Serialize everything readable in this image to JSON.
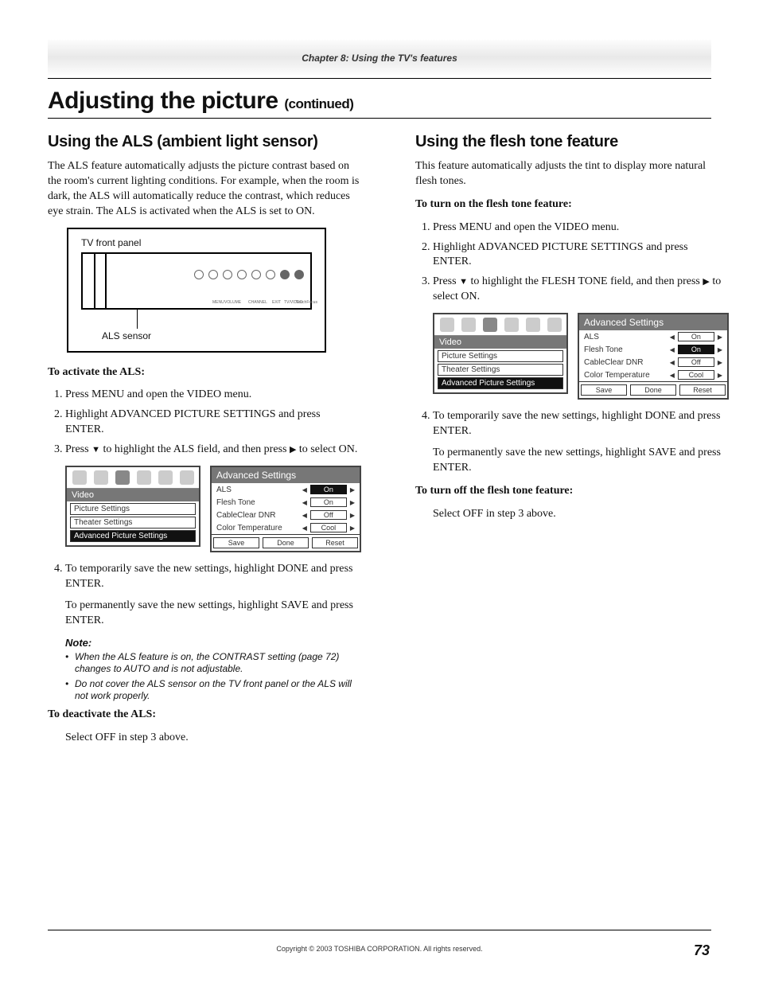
{
  "header": {
    "chapter": "Chapter 8: Using the TV's features"
  },
  "h1": {
    "title": "Adjusting the picture",
    "cont": "(continued)"
  },
  "left": {
    "h2": "Using the ALS (ambient light sensor)",
    "intro": "The ALS feature automatically adjusts the picture contrast based on the room's current lighting conditions. For example, when the room is dark, the ALS will automatically reduce the contrast, which reduces eye strain. The ALS is activated when the ALS is set to ON.",
    "tv_label_top": "TV front panel",
    "tv_label_sensor": "ALS sensor",
    "activate_hd": "To activate the ALS:",
    "steps": {
      "s1": "Press MENU and open the VIDEO menu.",
      "s2": "Highlight ADVANCED PICTURE SETTINGS and press ENTER.",
      "s3a": "Press ",
      "s3b": " to highlight the ALS field, and then press ",
      "s3c": " to select ON.",
      "s4": "To temporarily save the new settings, highlight DONE and press ENTER.",
      "s4p2": "To permanently save the new settings, highlight SAVE and press ENTER."
    },
    "note_hd": "Note:",
    "note1": "When the ALS feature is on, the CONTRAST setting (page 72) changes to AUTO and is not adjustable.",
    "note2": "Do not cover the ALS sensor on the TV front panel or the ALS will not work properly.",
    "deactivate_hd": "To deactivate the ALS:",
    "deactivate_body": "Select OFF in step 3 above."
  },
  "right": {
    "h2": "Using the flesh tone feature",
    "intro": "This feature automatically adjusts the tint to display more natural flesh tones.",
    "on_hd": "To turn on the flesh tone feature:",
    "steps": {
      "s1": "Press MENU and open the VIDEO menu.",
      "s2": "Highlight ADVANCED PICTURE SETTINGS and press ENTER.",
      "s3a": "Press ",
      "s3b": " to highlight the FLESH TONE field, and then press ",
      "s3c": " to select ON.",
      "s4": "To temporarily save the new settings, highlight DONE and press ENTER.",
      "s4p2": "To permanently save the new settings, highlight SAVE and press ENTER."
    },
    "off_hd": "To turn off the flesh tone feature:",
    "off_body": "Select OFF in step 3 above."
  },
  "menu": {
    "cat_title": "Video",
    "cat_items": [
      "Picture Settings",
      "Theater Settings",
      "Advanced Picture Settings"
    ],
    "adv_title": "Advanced Settings",
    "rows": {
      "als_lbl": "ALS",
      "als_val": "On",
      "ft_lbl": "Flesh Tone",
      "ft_val": "On",
      "cc_lbl": "CableClear DNR",
      "cc_val": "Off",
      "ct_lbl": "Color Temperature",
      "ct_val": "Cool"
    },
    "btns": {
      "save": "Save",
      "done": "Done",
      "reset": "Reset"
    },
    "knobs": [
      "MENU",
      "VOLUME",
      "",
      "CHANNEL",
      "",
      "EXIT",
      "TV/VIDEO",
      "TouchFocus"
    ]
  },
  "footer": {
    "copyright": "Copyright © 2003 TOSHIBA CORPORATION. All rights reserved.",
    "page": "73"
  }
}
